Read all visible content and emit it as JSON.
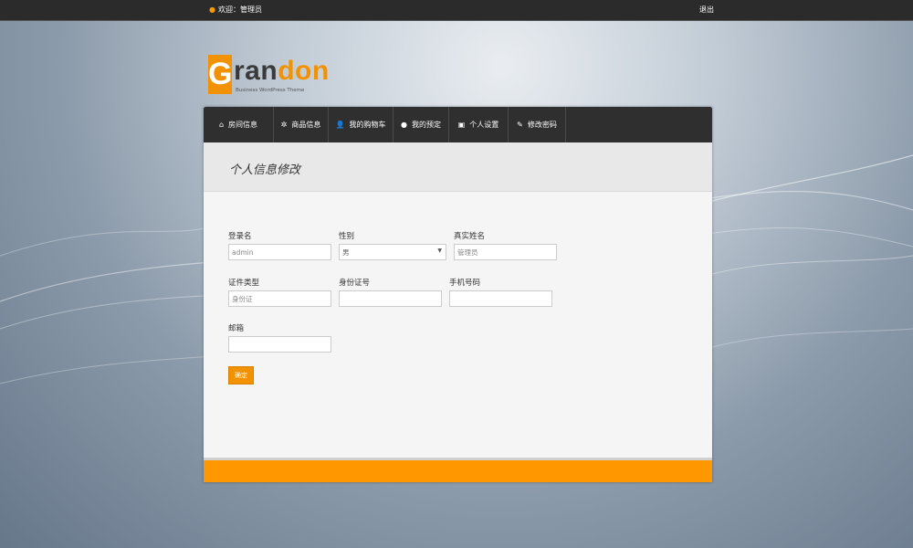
{
  "topbar": {
    "welcome": "欢迎：管理员",
    "logout": "退出"
  },
  "logo": {
    "first_letter": "G",
    "rest_dark": "ran",
    "rest_orange": "don",
    "tagline": "Business WordPress Theme"
  },
  "nav": [
    {
      "label": "房间信息",
      "icon": "home-icon",
      "glyph": "⌂"
    },
    {
      "label": "商品信息",
      "icon": "gear-icon",
      "glyph": "✲"
    },
    {
      "label": "我的购物车",
      "icon": "user-icon",
      "glyph": "👤"
    },
    {
      "label": "我的预定",
      "icon": "pin-icon",
      "glyph": "●"
    },
    {
      "label": "个人设置",
      "icon": "briefcase-icon",
      "glyph": "▣"
    },
    {
      "label": "修改密码",
      "icon": "pencil-icon",
      "glyph": "✎"
    }
  ],
  "page": {
    "title": "个人信息修改"
  },
  "form": {
    "login_label": "登录名",
    "login_value": "admin",
    "gender_label": "性别",
    "gender_value": "男",
    "realname_label": "真实姓名",
    "realname_value": "管理员",
    "idtype_label": "证件类型",
    "idtype_value": "身份证",
    "idnum_label": "身份证号",
    "idnum_value": "",
    "phone_label": "手机号码",
    "phone_value": "",
    "email_label": "邮箱",
    "email_value": "",
    "submit_label": "确定"
  },
  "colors": {
    "accent": "#f39200",
    "nav_bg": "#2f2f2f",
    "footer": "#ff9800"
  }
}
